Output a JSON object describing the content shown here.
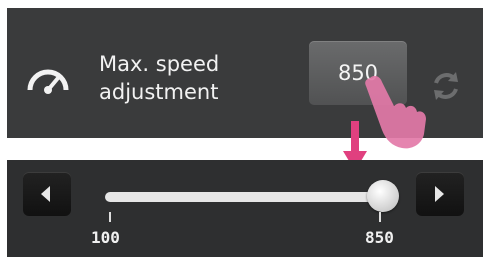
{
  "setting": {
    "label_line1": "Max. speed",
    "label_line2": "adjustment",
    "value": "850",
    "icon": "speedometer-icon",
    "reset_icon": "refresh-icon"
  },
  "slider": {
    "min": 100,
    "max": 850,
    "current": 850,
    "min_label": "100",
    "max_label": "850",
    "decrease_icon": "arrow-left-icon",
    "increase_icon": "arrow-right-icon"
  },
  "annotations": {
    "pointer_icon": "tapping-hand-icon",
    "arrow_color": "#e0407f"
  },
  "colors": {
    "panel": "#3a3b3c",
    "slider_panel": "#2e2f30",
    "track": "#e6e6e6"
  }
}
